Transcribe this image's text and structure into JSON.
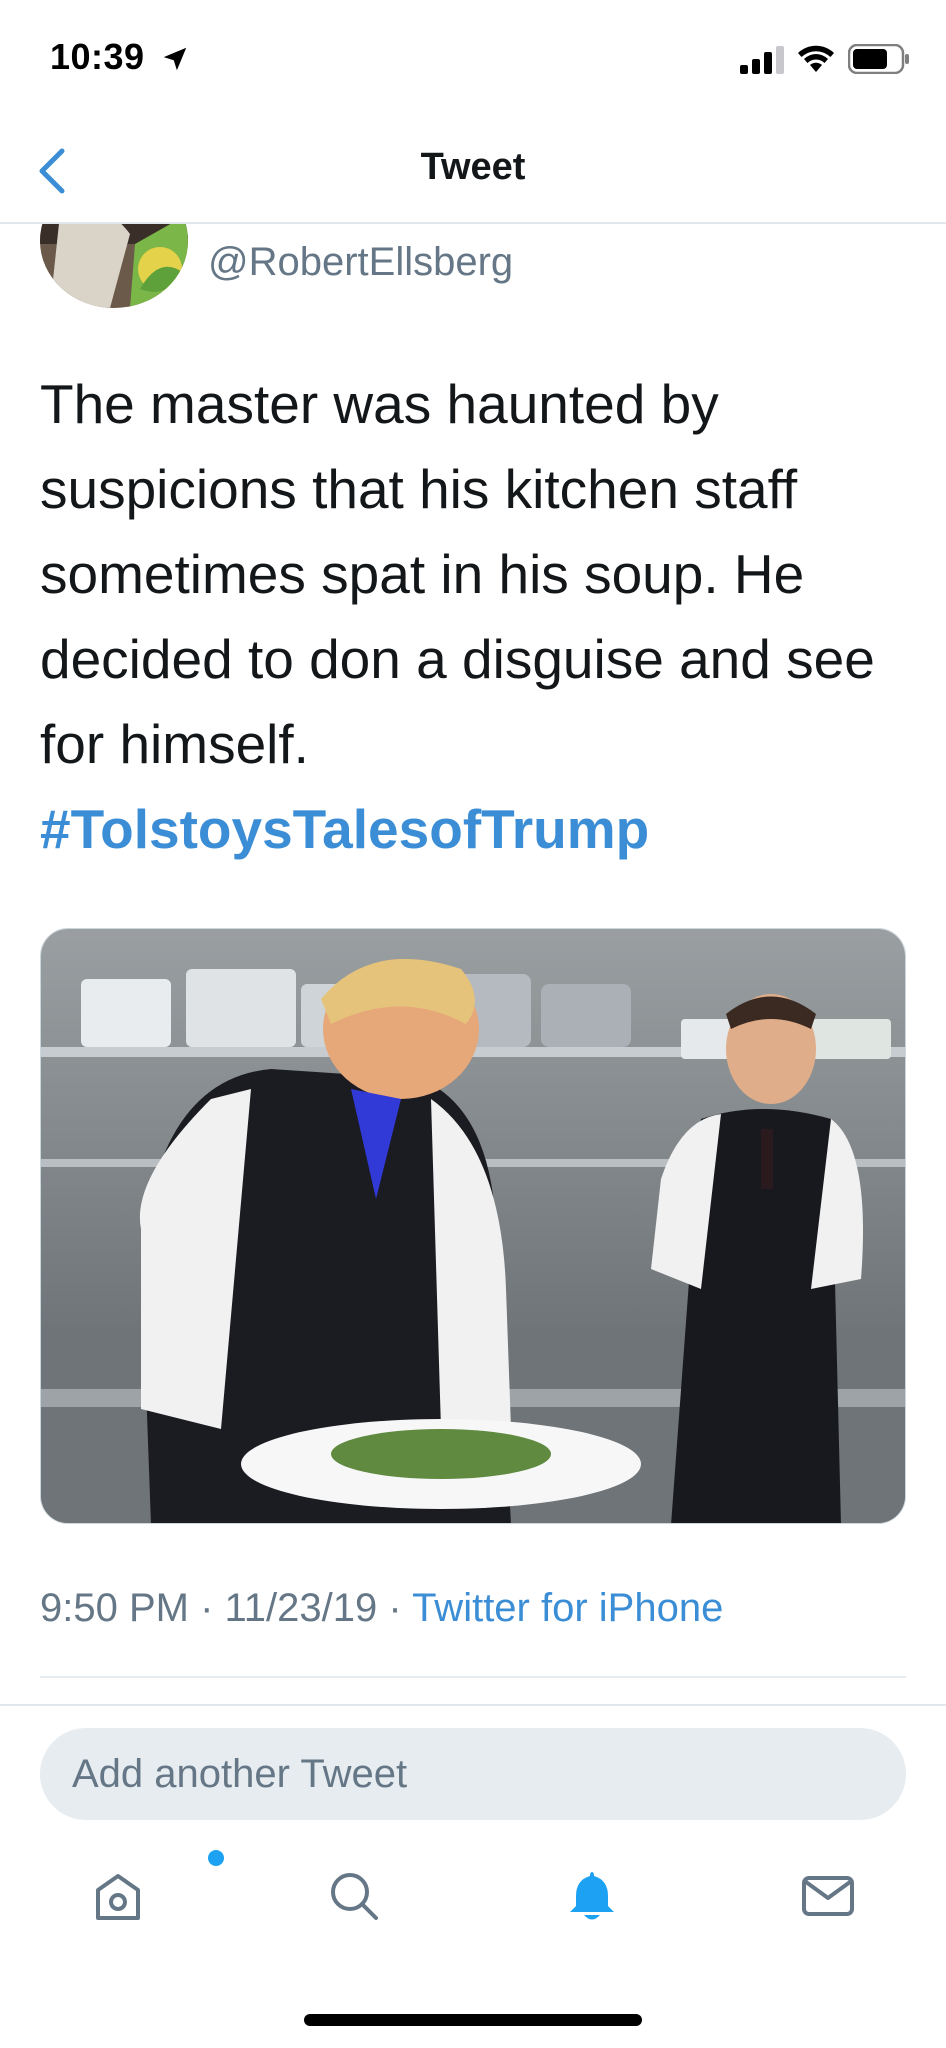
{
  "status_bar": {
    "time": "10:39",
    "icons": [
      "location-arrow-icon",
      "signal-icon",
      "wifi-icon",
      "battery-icon"
    ]
  },
  "nav": {
    "title": "Tweet",
    "back_icon": "chevron-left-icon"
  },
  "tweet": {
    "author_name_partial": "@RobertEllsberg",
    "handle": "@RobertEllsberg",
    "text": "The master was haunted by suspicions that his kitchen staff sometimes spat in his soup. He decided to don a disguise and see for himself.",
    "hashtag": "#TolstoysTalesofTrump",
    "timestamp": "9:50 PM · 11/23/19 · ",
    "source": "Twitter for iPhone"
  },
  "composer": {
    "placeholder": "Add another Tweet"
  },
  "tab_bar": {
    "items": [
      "home-icon",
      "search-icon",
      "notifications-icon",
      "messages-icon"
    ]
  },
  "colors": {
    "accent": "#1da1f2",
    "link": "#3b8ed6",
    "muted": "#657786",
    "divider": "#e6ecf0"
  }
}
